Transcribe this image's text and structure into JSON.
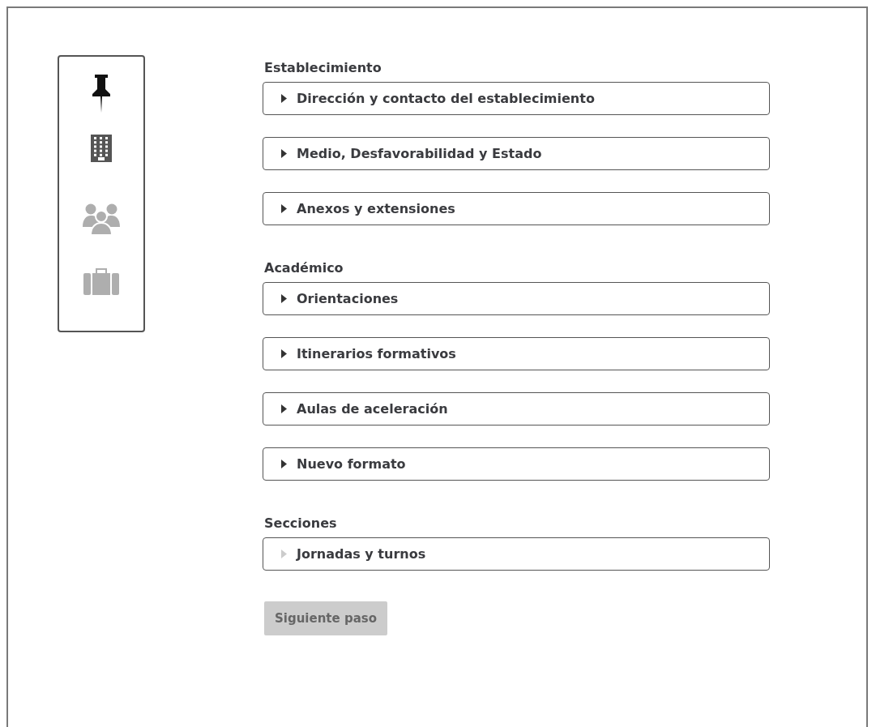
{
  "nav_items": [
    {
      "kind": "pin",
      "selected": true,
      "disabled": false
    },
    {
      "kind": "building",
      "selected": false,
      "disabled": false
    },
    {
      "kind": "people",
      "selected": false,
      "disabled": true
    },
    {
      "kind": "briefcase",
      "selected": false,
      "disabled": true
    }
  ],
  "sections": [
    {
      "title": "Establecimiento",
      "items": [
        {
          "label": "Dirección y contacto del establecimiento",
          "disabled": false
        },
        {
          "label": "Medio, Desfavorabilidad y Estado",
          "disabled": false
        },
        {
          "label": "Anexos y extensiones",
          "disabled": false
        }
      ]
    },
    {
      "title": "Académico",
      "items": [
        {
          "label": "Orientaciones",
          "disabled": false
        },
        {
          "label": "Itinerarios formativos",
          "disabled": false
        },
        {
          "label": "Aulas de aceleración",
          "disabled": false
        },
        {
          "label": "Nuevo formato",
          "disabled": false
        }
      ]
    },
    {
      "title": "Secciones",
      "items": [
        {
          "label": "Jornadas y turnos",
          "disabled": true
        }
      ]
    }
  ],
  "next_button": {
    "label": "Siguiente paso",
    "disabled": true
  }
}
